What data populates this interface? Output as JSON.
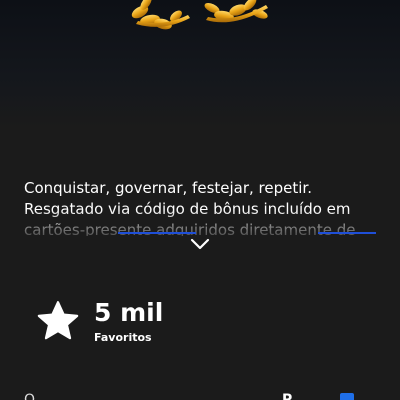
{
  "product": {
    "description": "Conquistar, governar, festejar, repetir. Resgatado via código de bônus incluído em cartões-presente adquiridos diretamente de",
    "expand_icon": "chevron-down-icon",
    "hero_icon": "golden-laurel-icon"
  },
  "favorites": {
    "count": "5 mil",
    "label": "Favoritos",
    "icon": "star-icon"
  },
  "colors": {
    "background": "#1b1b1b",
    "text": "#ffffff",
    "accent": "#1f4fd8",
    "gold": "#e9a417"
  }
}
